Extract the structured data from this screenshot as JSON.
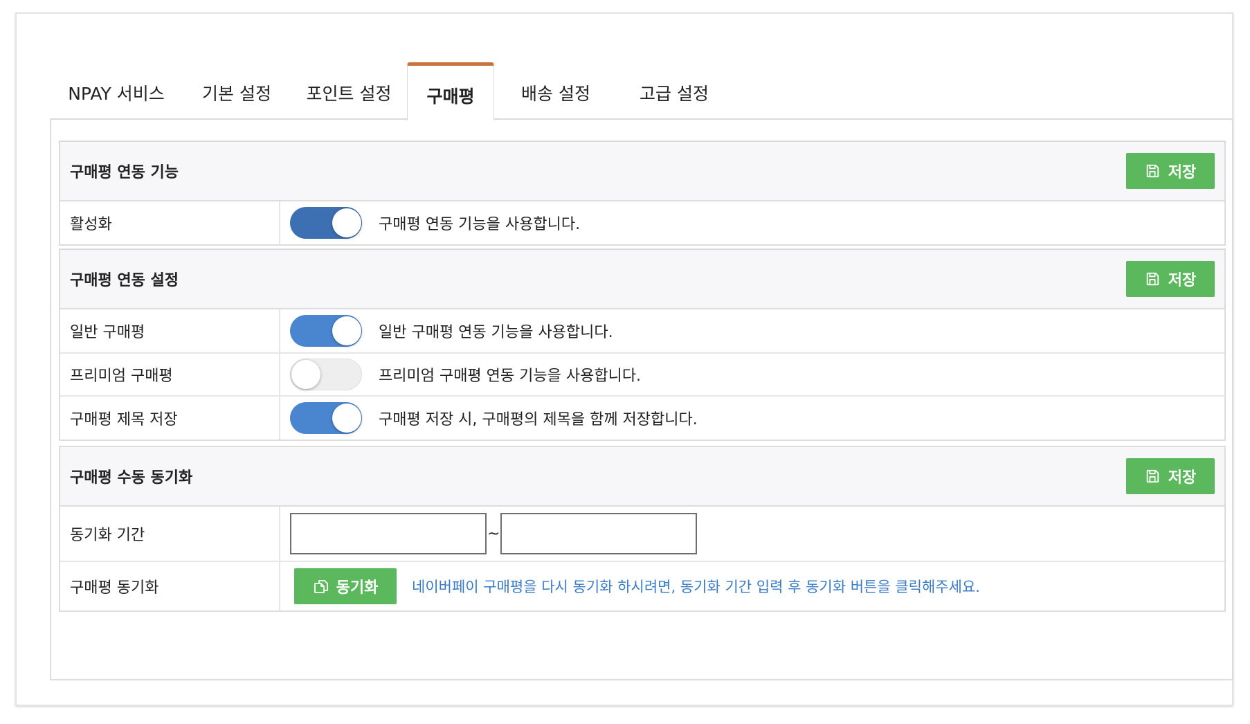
{
  "tabs": [
    {
      "label": "NPAY 서비스",
      "active": false
    },
    {
      "label": "기본 설정",
      "active": false
    },
    {
      "label": "포인트 설정",
      "active": false
    },
    {
      "label": "구매평",
      "active": true
    },
    {
      "label": "배송 설정",
      "active": false
    },
    {
      "label": "고급 설정",
      "active": false
    }
  ],
  "colors": {
    "active_tab_accent": "#c8733a",
    "save_button": "#5cb85c",
    "toggle_on": "#4a86cf",
    "toggle_off": "#eeeeee",
    "help_text": "#3a7bc8"
  },
  "sections": {
    "feature": {
      "title": "구매평 연동 기능",
      "save_label": "저장",
      "rows": [
        {
          "label": "활성화",
          "enabled": true,
          "description": "구매평 연동 기능을 사용합니다."
        }
      ]
    },
    "settings": {
      "title": "구매평 연동 설정",
      "save_label": "저장",
      "rows": [
        {
          "label": "일반 구매평",
          "enabled": true,
          "description": "일반 구매평 연동 기능을 사용합니다."
        },
        {
          "label": "프리미엄 구매평",
          "enabled": false,
          "description": "프리미엄 구매평 연동 기능을 사용합니다."
        },
        {
          "label": "구매평 제목 저장",
          "enabled": true,
          "description": "구매평 저장 시, 구매평의 제목을 함께 저장합니다."
        }
      ]
    },
    "manual_sync": {
      "title": "구매평 수동 동기화",
      "save_label": "저장",
      "period": {
        "label": "동기화 기간",
        "start_value": "",
        "end_value": "",
        "separator": "~"
      },
      "sync": {
        "label": "구매평 동기화",
        "button_label": "동기화",
        "help": "네이버페이 구매평을 다시 동기화 하시려면, 동기화 기간 입력 후 동기화 버튼을 클릭해주세요."
      }
    }
  },
  "icons": {
    "save": "floppy-disk-icon",
    "sync": "copy-icon"
  }
}
